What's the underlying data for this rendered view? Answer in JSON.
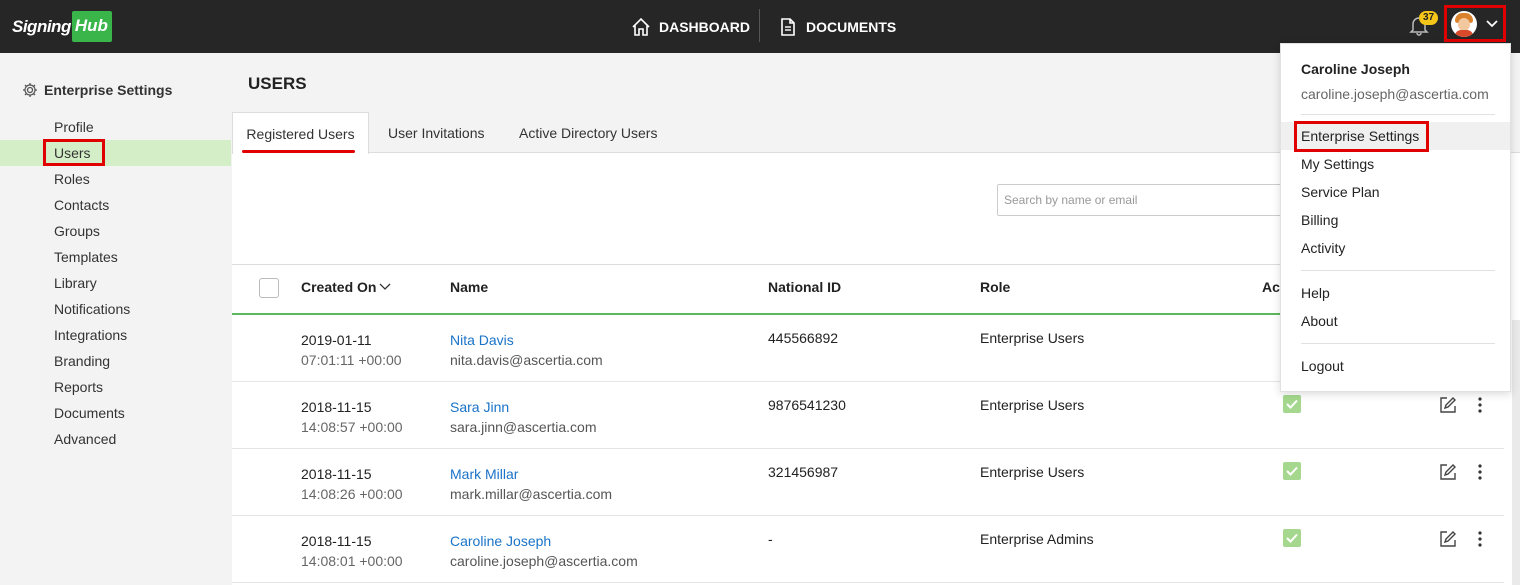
{
  "brand": {
    "part1": "Signing",
    "part2": "Hub"
  },
  "topnav": {
    "dashboard": "DASHBOARD",
    "documents": "DOCUMENTS",
    "notifications_count": "37"
  },
  "sidebar": {
    "title": "Enterprise Settings",
    "items": [
      {
        "label": "Profile"
      },
      {
        "label": "Users",
        "active": true
      },
      {
        "label": "Roles"
      },
      {
        "label": "Contacts"
      },
      {
        "label": "Groups"
      },
      {
        "label": "Templates"
      },
      {
        "label": "Library"
      },
      {
        "label": "Notifications"
      },
      {
        "label": "Integrations"
      },
      {
        "label": "Branding"
      },
      {
        "label": "Reports"
      },
      {
        "label": "Documents"
      },
      {
        "label": "Advanced"
      }
    ]
  },
  "main": {
    "title": "USERS",
    "tabs": [
      "Registered Users",
      "User Invitations",
      "Active Directory Users"
    ],
    "search_placeholder": "Search by name or email",
    "columns": {
      "created": "Created On",
      "name": "Name",
      "nid": "National ID",
      "role": "Role",
      "active": "Act"
    },
    "rows": [
      {
        "date": "2019-01-11",
        "time": "07:01:11 +00:00",
        "name": "Nita Davis",
        "email": "nita.davis@ascertia.com",
        "nid": "445566892",
        "role": "Enterprise Users"
      },
      {
        "date": "2018-11-15",
        "time": "14:08:57 +00:00",
        "name": "Sara Jinn",
        "email": "sara.jinn@ascertia.com",
        "nid": "9876541230",
        "role": "Enterprise Users"
      },
      {
        "date": "2018-11-15",
        "time": "14:08:26 +00:00",
        "name": "Mark Millar",
        "email": "mark.millar@ascertia.com",
        "nid": "321456987",
        "role": "Enterprise Users"
      },
      {
        "date": "2018-11-15",
        "time": "14:08:01 +00:00",
        "name": "Caroline Joseph",
        "email": "caroline.joseph@ascertia.com",
        "nid": "-",
        "role": "Enterprise Admins"
      }
    ]
  },
  "user_menu": {
    "name": "Caroline Joseph",
    "email": "caroline.joseph@ascertia.com",
    "items": [
      "Enterprise Settings",
      "My Settings",
      "Service Plan",
      "Billing",
      "Activity"
    ],
    "items2": [
      "Help",
      "About"
    ],
    "logout": "Logout"
  },
  "colors": {
    "topbar": "#262626",
    "brand_green": "#39b54a",
    "highlight_red": "#e00000",
    "link_blue": "#1a73c8",
    "active_green": "#a5d88e"
  }
}
